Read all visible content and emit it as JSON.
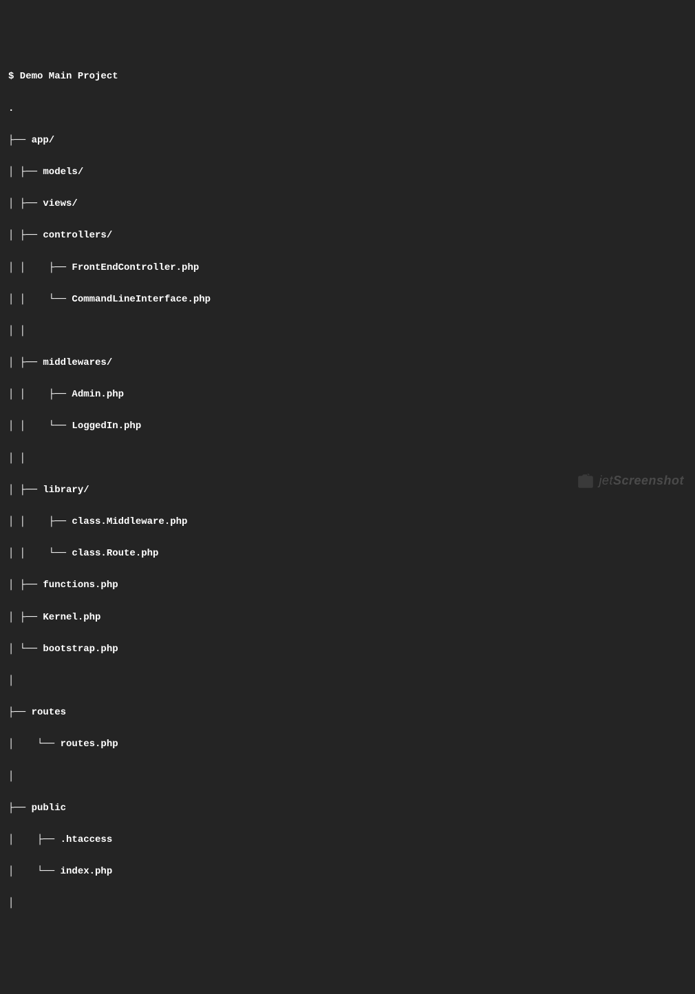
{
  "prompt": "$ Demo Main Project",
  "tree": [
    ".",
    "├── app/",
    "│ ├── models/",
    "│ ├── views/",
    "│ ├── controllers/",
    "│ │    ├── FrontEndController.php",
    "│ │    └── CommandLineInterface.php",
    "│ │",
    "│ ├── middlewares/",
    "│ │    ├── Admin.php",
    "│ │    └── LoggedIn.php",
    "│ │",
    "│ ├── library/",
    "│ │    ├── class.Middleware.php",
    "│ │    └── class.Route.php",
    "│ ├── functions.php",
    "│ ├── Kernel.php",
    "│ └── bootstrap.php",
    "│",
    "├── routes",
    "│    └── routes.php",
    "│",
    "├── public",
    "│    ├── .htaccess",
    "│    └── index.php",
    "│"
  ],
  "watermark": {
    "prefix": "jet",
    "suffix": "Screenshot"
  }
}
